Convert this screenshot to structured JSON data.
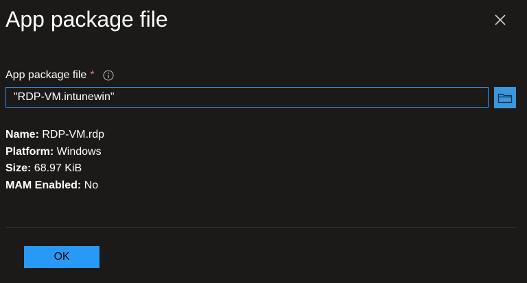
{
  "dialog": {
    "title": "App package file"
  },
  "field": {
    "label": "App package file",
    "required_marker": "*",
    "value": "\"RDP-VM.intunewin\""
  },
  "details": {
    "name_label": "Name:",
    "name_value": "RDP-VM.rdp",
    "platform_label": "Platform:",
    "platform_value": "Windows",
    "size_label": "Size:",
    "size_value": "68.97 KiB",
    "mam_label": "MAM Enabled:",
    "mam_value": "No"
  },
  "footer": {
    "ok_label": "OK"
  },
  "icons": {
    "close": "close-icon",
    "info": "info-icon",
    "browse": "folder-icon"
  },
  "colors": {
    "background": "#1b1a19",
    "accent": "#2899f5",
    "input_border": "#3c8dde",
    "required": "#f1707b"
  }
}
